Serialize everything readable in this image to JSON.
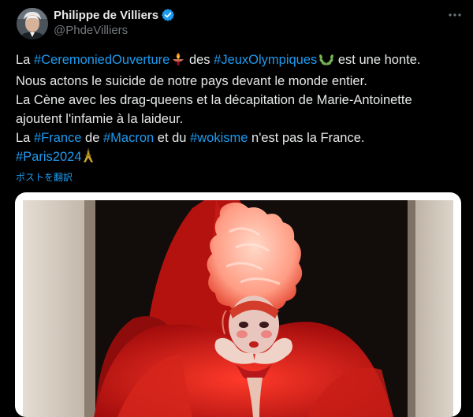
{
  "author": {
    "display_name": "Philippe de Villiers",
    "handle": "@PhdeVilliers",
    "verified": true,
    "avatar_icon": "profile-photo"
  },
  "more_icon": "more-horizontal-icon",
  "tweet": {
    "line1": {
      "t1": "La ",
      "tag1": "#CeremoniedOuverture",
      "emoji1": "olympic-torch-emoji",
      "t2": " des ",
      "tag2": "#JeuxOlympiques",
      "emoji2": "laurel-wreath-emoji",
      "t3": " est une honte."
    },
    "line2": "Nous actons le suicide de notre pays devant le monde entier.",
    "line3": "La Cène avec les drag-queens et la décapitation de Marie-Antoinette",
    "line4": "ajoutent l'infamie à la laideur.",
    "line5": {
      "t1": "La ",
      "tag1": "#France",
      "t2": " de ",
      "tag2": "#Macron",
      "t3": " et du ",
      "tag3": "#wokisme",
      "t4": " n'est pas la France."
    },
    "line6": {
      "tag1": "#Paris2024",
      "emoji1": "eiffel-tower-emoji"
    }
  },
  "translate_label": "ポストを翻訳",
  "colors": {
    "background": "#000000",
    "text": "#e7e9ea",
    "secondary_text": "#71767b",
    "link": "#1d9bf0",
    "verified_badge": "#1d9bf0"
  }
}
